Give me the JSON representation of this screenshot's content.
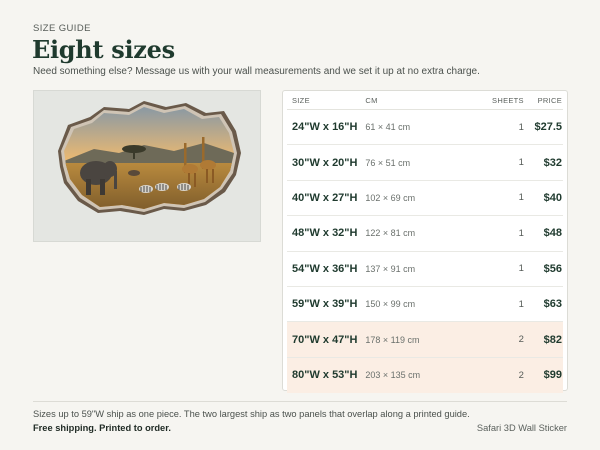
{
  "header": {
    "eyebrow": "SIZE GUIDE",
    "title": "Eight sizes",
    "subtitle": "Need something else? Message us with your wall measurements and we set it up at no extra charge."
  },
  "product_image": {
    "icon": "safari-broken-wall-illustration"
  },
  "size_table": {
    "columns": [
      "SIZE",
      "CM",
      "SHEETS",
      "PRICE"
    ],
    "rows": [
      {
        "size": "24\"W x 16\"H",
        "cm": "61 × 41 cm",
        "sheets": "1",
        "price": "$27.5"
      },
      {
        "size": "30\"W x 20\"H",
        "cm": "76 × 51 cm",
        "sheets": "1",
        "price": "$32"
      },
      {
        "size": "40\"W x 27\"H",
        "cm": "102 × 69 cm",
        "sheets": "1",
        "price": "$40"
      },
      {
        "size": "48\"W x 32\"H",
        "cm": "122 × 81 cm",
        "sheets": "1",
        "price": "$48"
      },
      {
        "size": "54\"W x 36\"H",
        "cm": "137 × 91 cm",
        "sheets": "1",
        "price": "$56"
      },
      {
        "size": "59\"W x 39\"H",
        "cm": "150 × 99 cm",
        "sheets": "1",
        "price": "$63"
      },
      {
        "size": "70\"W x 47\"H",
        "cm": "178 × 119 cm",
        "sheets": "2",
        "price": "$82"
      },
      {
        "size": "80\"W x 53\"H",
        "cm": "203 × 135 cm",
        "sheets": "2",
        "price": "$99"
      }
    ],
    "highlight_color": "#fbeee4"
  },
  "footer": {
    "note": "Sizes up to 59\"W ship as one piece. The two largest ship as two panels that overlap along a printed guide.",
    "shipping": "Free shipping. Printed to order.",
    "product_name": "Safari 3D Wall Sticker"
  },
  "colors": {
    "accent": "#1f3a2e",
    "background": "#f6f5f1"
  }
}
